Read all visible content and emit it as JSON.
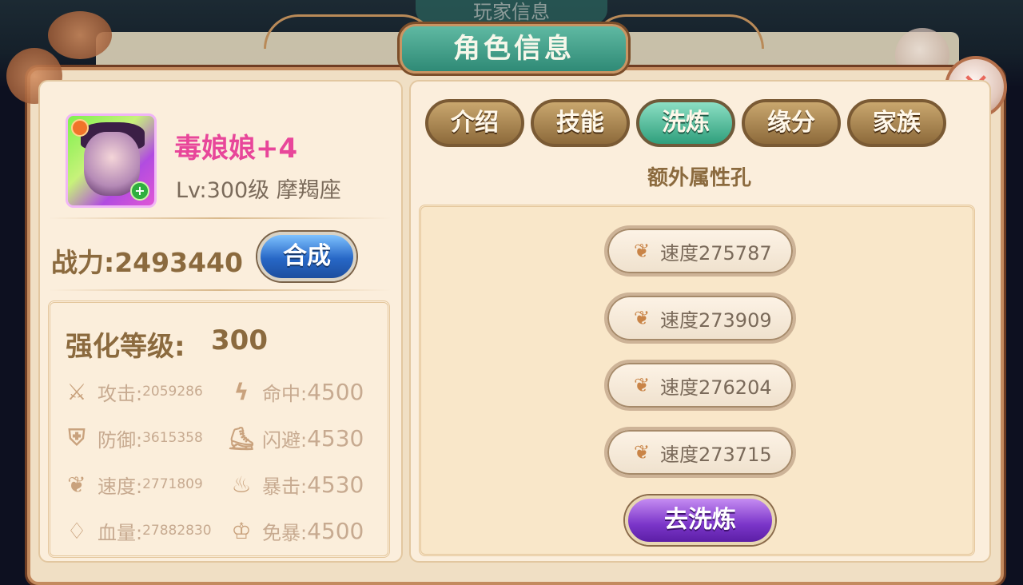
{
  "background_title": "玩家信息",
  "title": "角色信息",
  "character": {
    "name": "毒娘娘+4",
    "level": "Lv:300级 摩羯座",
    "power": "战力:2493440",
    "compose_label": "合成"
  },
  "enhance": {
    "label": "强化等级:",
    "value": "300"
  },
  "stats": [
    {
      "icon": "sword-icon",
      "label": "攻击:",
      "value": "2059286"
    },
    {
      "icon": "lightning-icon",
      "label": "命中:",
      "value": "4500"
    },
    {
      "icon": "shield-icon",
      "label": "防御:",
      "value": "3615358"
    },
    {
      "icon": "shoe-icon",
      "label": "闪避:",
      "value": "4530"
    },
    {
      "icon": "wing-icon",
      "label": "速度:",
      "value": "2771809"
    },
    {
      "icon": "flame-icon",
      "label": "暴击:",
      "value": "4530"
    },
    {
      "icon": "drop-icon",
      "label": "血量:",
      "value": "27882830"
    },
    {
      "icon": "crest-icon",
      "label": "免暴:",
      "value": "4500"
    }
  ],
  "tabs": [
    {
      "label": "介绍",
      "active": false
    },
    {
      "label": "技能",
      "active": false
    },
    {
      "label": "洗炼",
      "active": true
    },
    {
      "label": "缘分",
      "active": false
    },
    {
      "label": "家族",
      "active": false
    }
  ],
  "section_title": "额外属性孔",
  "slots": [
    {
      "icon": "wing-icon",
      "text": "速度275787"
    },
    {
      "icon": "wing-icon",
      "text": "速度273909"
    },
    {
      "icon": "wing-icon",
      "text": "速度276204"
    },
    {
      "icon": "wing-icon",
      "text": "速度273715"
    }
  ],
  "wash_button": "去洗炼",
  "colors": {
    "name_pink": "#e8469a",
    "active_tab": "#2f9f7c",
    "compose_blue": "#2767c6",
    "wash_purple": "#7b35c9"
  }
}
